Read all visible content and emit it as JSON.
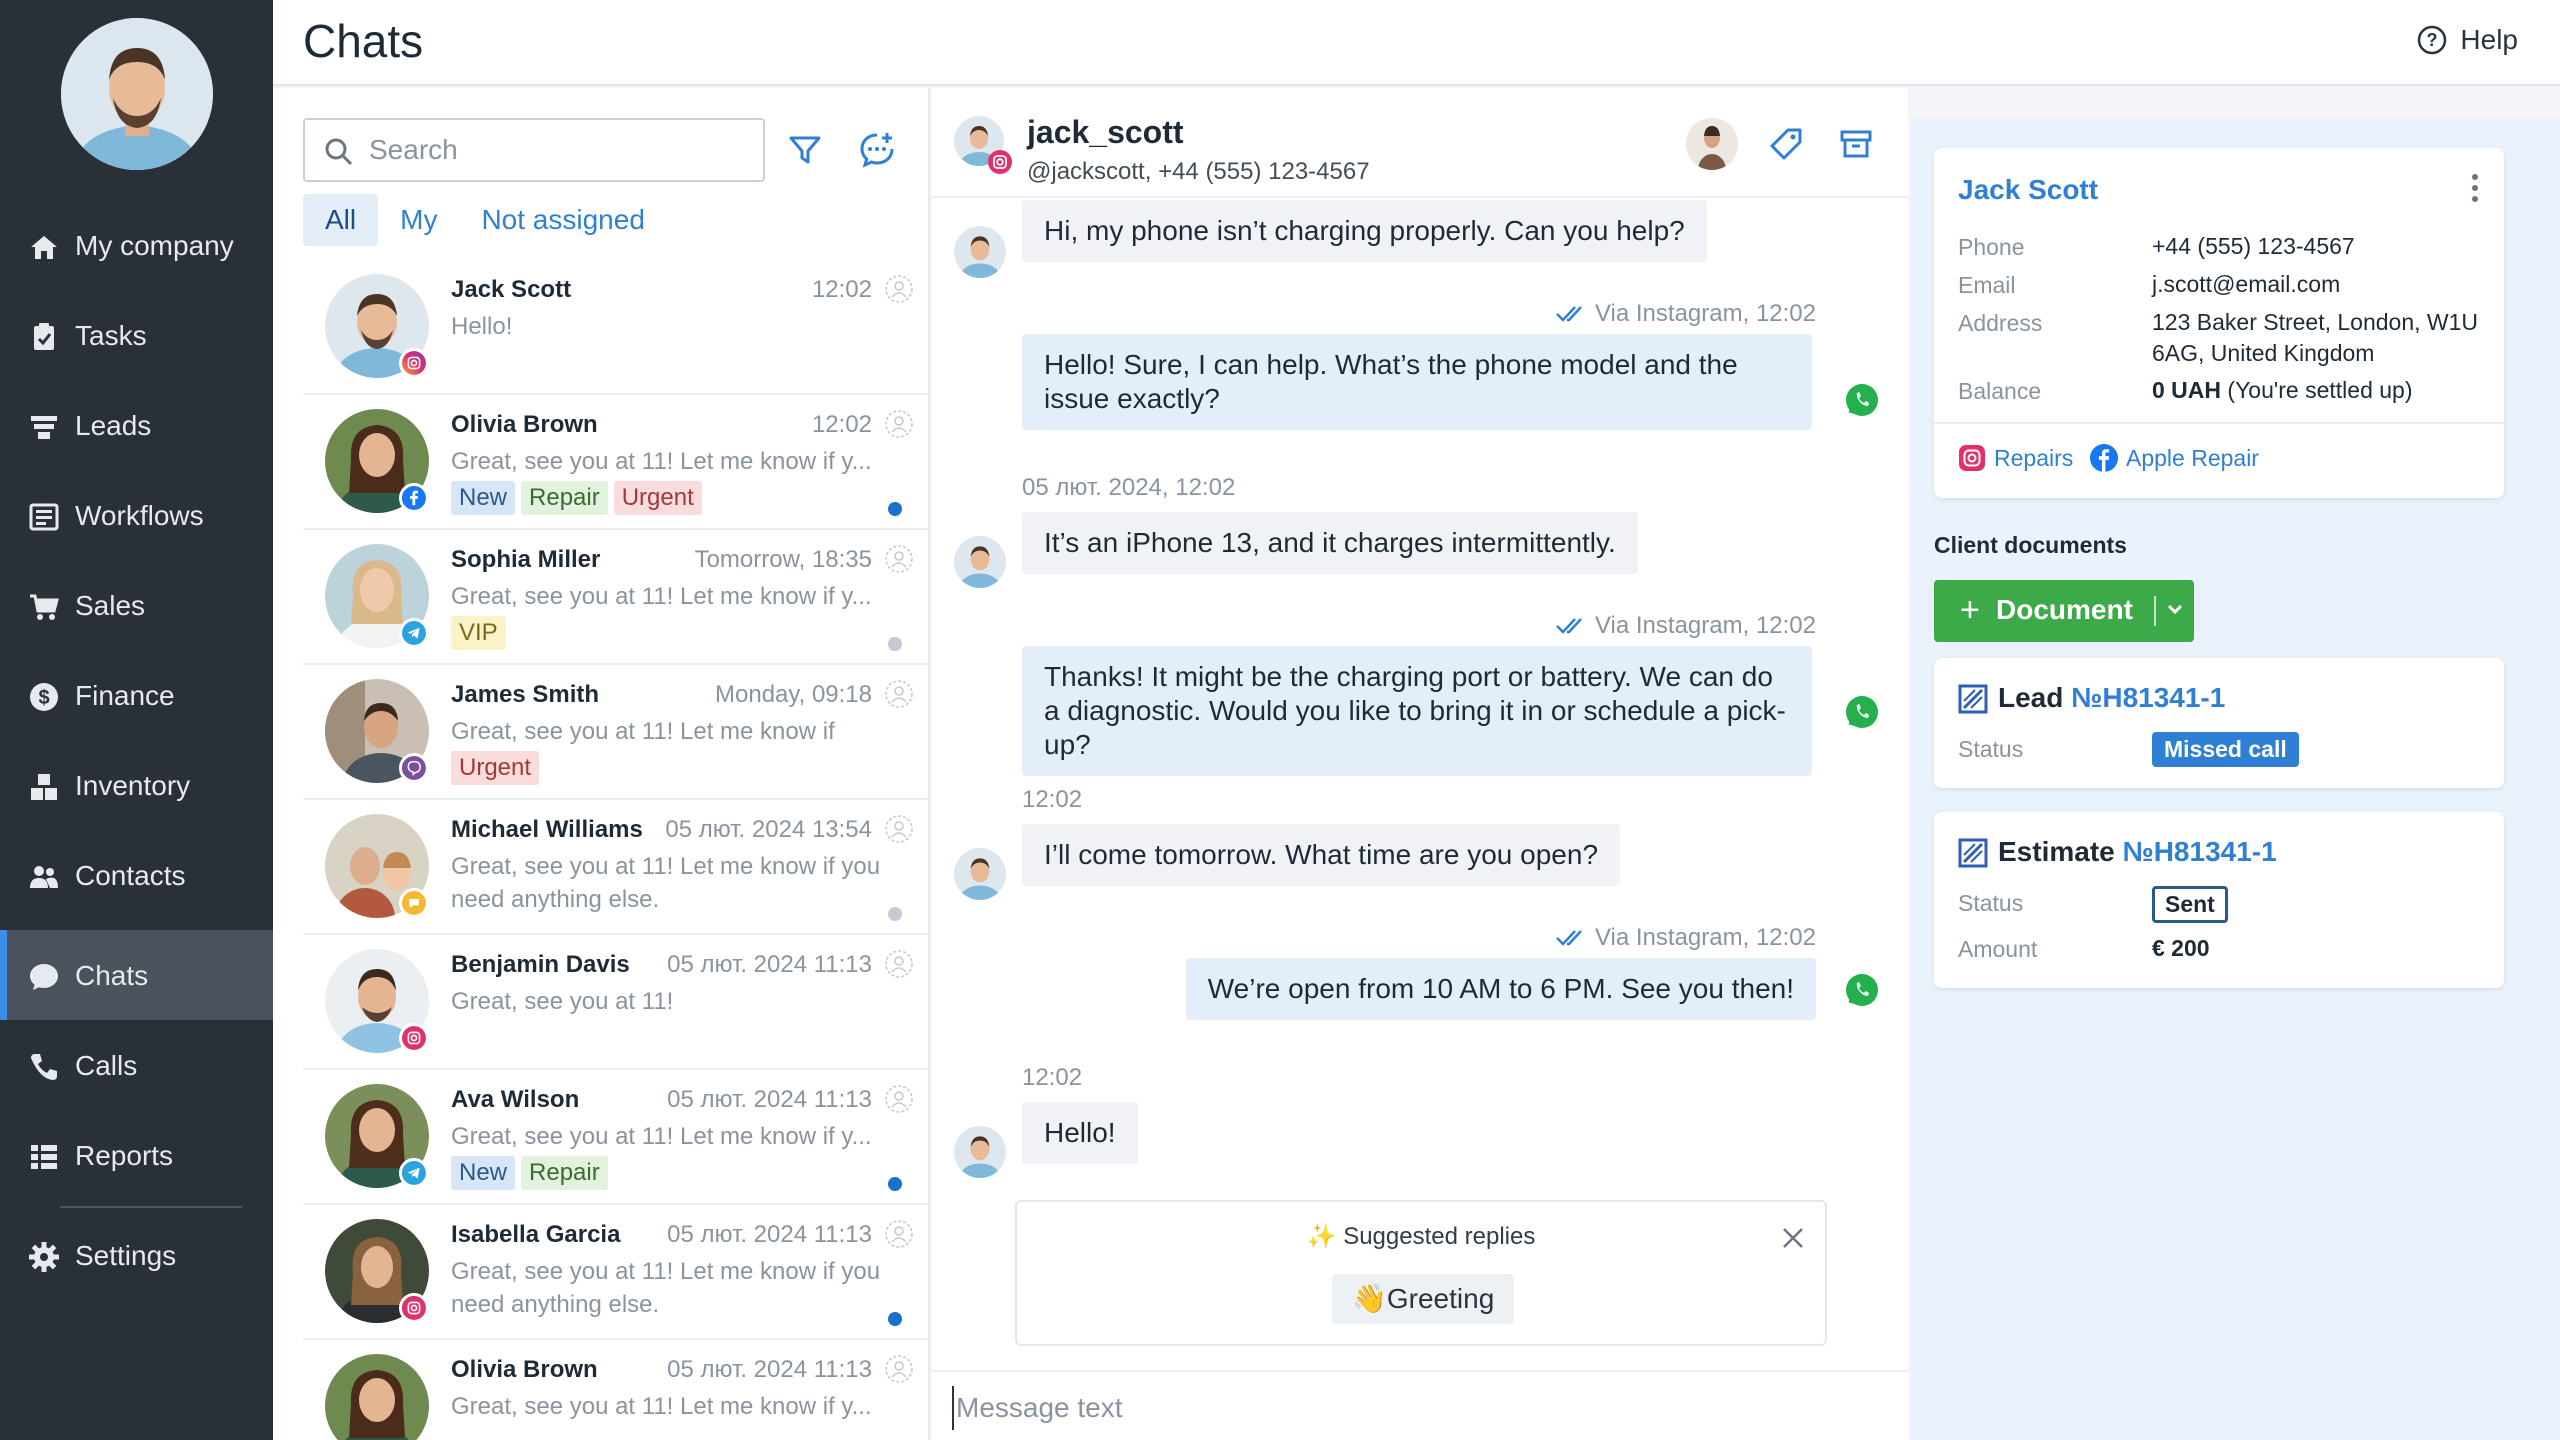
{
  "header": {
    "title": "Chats",
    "help_label": "Help"
  },
  "sidebar": {
    "items": [
      {
        "label": "My company",
        "icon": "home-icon"
      },
      {
        "label": "Tasks",
        "icon": "clipboard-icon"
      },
      {
        "label": "Leads",
        "icon": "funnel-icon"
      },
      {
        "label": "Workflows",
        "icon": "board-icon"
      },
      {
        "label": "Sales",
        "icon": "cart-icon"
      },
      {
        "label": "Finance",
        "icon": "dollar-icon"
      },
      {
        "label": "Inventory",
        "icon": "boxes-icon"
      },
      {
        "label": "Contacts",
        "icon": "people-icon"
      },
      {
        "label": "Chats",
        "icon": "chat-icon",
        "active": true
      },
      {
        "label": "Calls",
        "icon": "phone-icon"
      },
      {
        "label": "Reports",
        "icon": "list-icon"
      },
      {
        "label": "Settings",
        "icon": "gear-icon"
      }
    ]
  },
  "chat_list": {
    "search_placeholder": "Search",
    "tabs": [
      "All",
      "My",
      "Not assigned"
    ],
    "items": [
      {
        "name": "Jack Scott",
        "time": "12:02",
        "preview": "Hello!",
        "channel": "instagram",
        "tags": []
      },
      {
        "name": "Olivia Brown",
        "time": "12:02",
        "preview": "Great, see you at 11! Let me know if y...",
        "channel": "facebook",
        "tags": [
          "New",
          "Repair",
          "Urgent"
        ],
        "unread": "blue"
      },
      {
        "name": "Sophia Miller",
        "time": "Tomorrow, 18:35",
        "preview": "Great, see you at 11! Let me know if y...",
        "channel": "telegram",
        "tags": [
          "VIP"
        ],
        "unread": "grey"
      },
      {
        "name": "James Smith",
        "time": "Monday, 09:18",
        "preview": "Great, see you at 11! Let me know if you...",
        "channel": "viber",
        "tags": [
          "Urgent"
        ]
      },
      {
        "name": "Michael Williams",
        "time": "05 лют. 2024 13:54",
        "preview": "Great, see you at 11! Let me know if you need anything else.",
        "channel": "other",
        "tags": [],
        "unread": "grey"
      },
      {
        "name": "Benjamin Davis",
        "time": "05 лют. 2024 11:13",
        "preview": "Great, see you at 11!",
        "channel": "instagram",
        "tags": []
      },
      {
        "name": "Ava Wilson",
        "time": "05 лют. 2024 11:13",
        "preview": "Great, see you at 11! Let me know if y...",
        "channel": "telegram",
        "tags": [
          "New",
          "Repair"
        ],
        "unread": "blue"
      },
      {
        "name": "Isabella Garcia",
        "time": "05 лют. 2024 11:13",
        "preview": "Great, see you at 11! Let me know if you need anything else.",
        "channel": "instagram",
        "tags": [],
        "unread": "blue"
      },
      {
        "name": "Olivia Brown",
        "time": "05 лют. 2024 11:13",
        "preview": "Great, see you at 11! Let me know if y...",
        "channel": "facebook",
        "tags": []
      }
    ]
  },
  "conversation": {
    "name": "jack_scott",
    "subtitle": "@jackscott, +44 (555) 123-4567",
    "messages": {
      "m1": "Hi, my phone isn’t charging properly. Can you help?",
      "via1": "Via Instagram, 12:02",
      "m2": "Hello! Sure, I can help. What’s the phone model and the issue exactly?",
      "date1": "05 лют. 2024, 12:02",
      "m3": "It’s an iPhone 13, and it charges intermittently.",
      "via2": "Via Instagram, 12:02",
      "m4": "Thanks! It might be the charging port or battery. We can do a diagnostic. Would you like to bring it in or schedule a pick-up?",
      "date2": "12:02",
      "m5": "I’ll come tomorrow. What time are you open?",
      "via3": "Via Instagram, 12:02",
      "m6": "We’re open from 10 AM to 6 PM. See you then!",
      "date3": "12:02",
      "m7": "Hello!"
    },
    "suggested_title": "Suggested replies",
    "suggested_chip": "Greeting",
    "message_placeholder": "Message text"
  },
  "client": {
    "name": "Jack Scott",
    "phone_label": "Phone",
    "phone": "+44 (555) 123-4567",
    "email_label": "Email",
    "email": "j.scott@email.com",
    "address_label": "Address",
    "address": "123 Baker Street, London, W1U 6AG, United Kingdom",
    "balance_label": "Balance",
    "balance_amount": "0 UAH",
    "balance_note": " (You're settled up)",
    "links": [
      "Repairs",
      "Apple Repair"
    ]
  },
  "documents": {
    "title": "Client documents",
    "button": "Document",
    "lead": {
      "type": "Lead",
      "number": "№H81341-1",
      "status_label": "Status",
      "status": "Missed call"
    },
    "estimate": {
      "type": "Estimate",
      "number": "№H81341-1",
      "status_label": "Status",
      "status": "Sent",
      "amount_label": "Amount",
      "amount": "€ 200"
    }
  },
  "colors": {
    "accent": "#2f7fd4",
    "sidebar_bg": "#2a3038",
    "success": "#3daa4a",
    "whatsapp": "#25b04e"
  }
}
